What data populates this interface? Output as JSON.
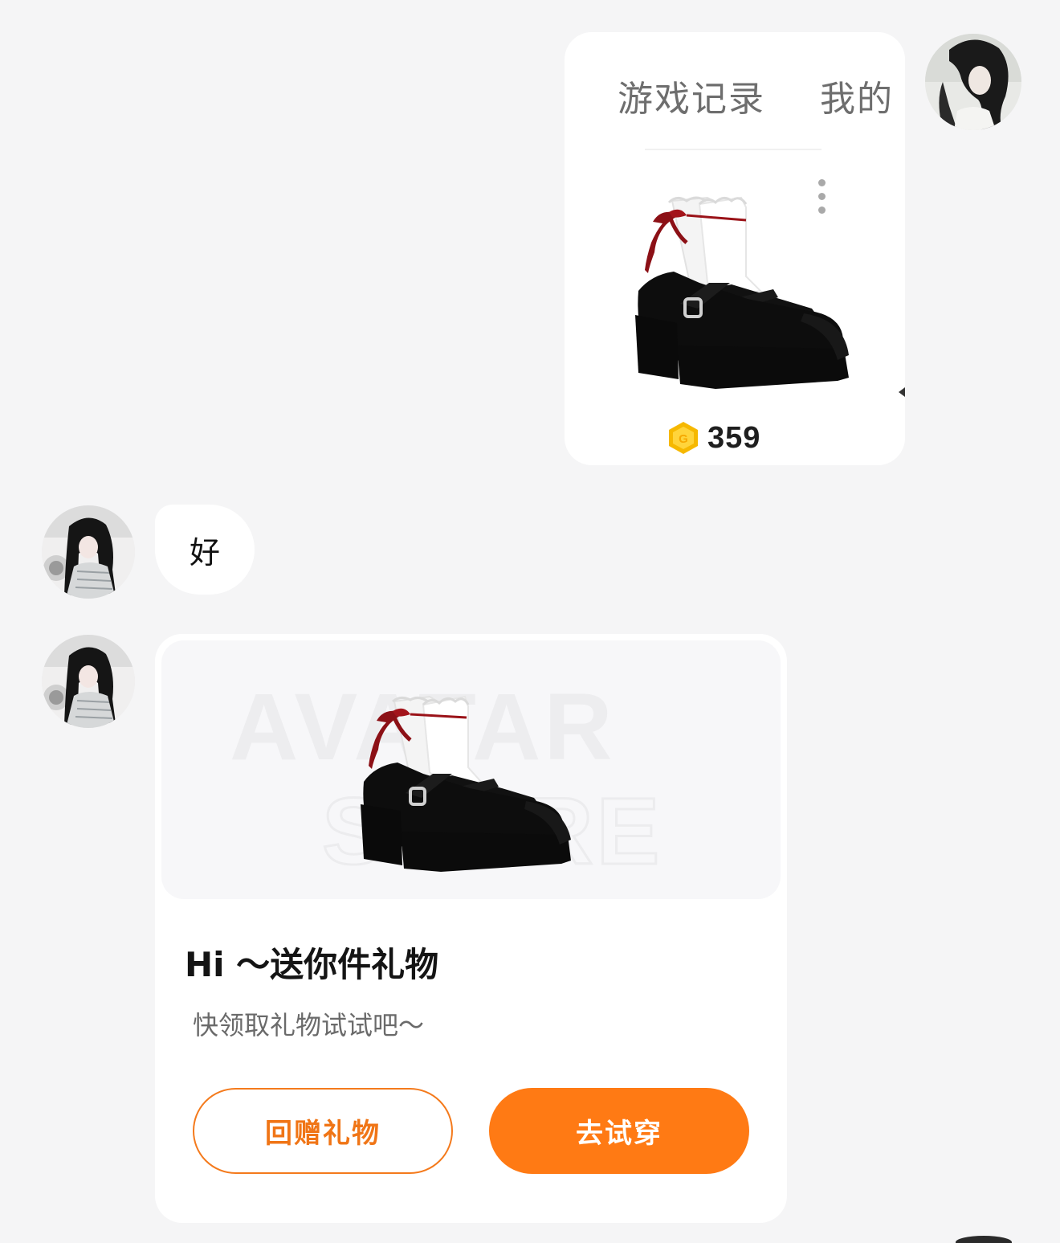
{
  "outgoing_card": {
    "tabs": [
      "游戏记录",
      "我的"
    ],
    "price": "359",
    "coin_icon": "gold-g-coin-icon",
    "more_icon": "vertical-ellipsis-icon"
  },
  "incoming_message": {
    "text": "好"
  },
  "gift_card": {
    "title": "Hi ～送你件礼物",
    "subtitle": "快领取礼物试试吧～",
    "return_gift_label": "回赠礼物",
    "try_on_label": "去试穿",
    "watermark_line1": "AVATAR",
    "watermark_line2": "STORE"
  },
  "colors": {
    "accent": "#ff7a14",
    "background": "#f5f5f6",
    "card": "#ffffff"
  }
}
